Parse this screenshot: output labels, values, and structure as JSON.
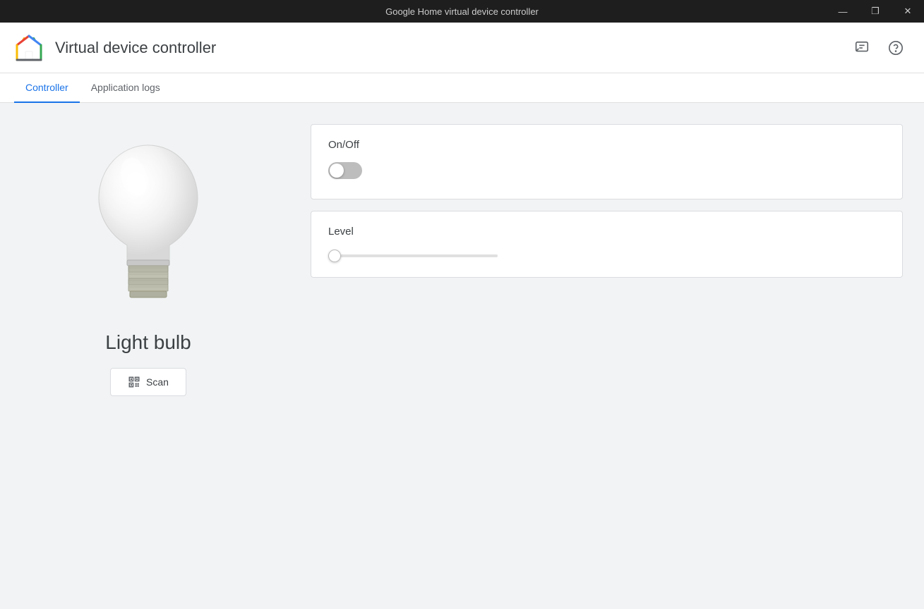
{
  "titleBar": {
    "title": "Google Home virtual device controller",
    "minimizeLabel": "—",
    "maximizeLabel": "❐",
    "closeLabel": "✕"
  },
  "header": {
    "appTitle": "Virtual device controller",
    "feedbackIconLabel": "feedback-icon",
    "helpIconLabel": "help-icon"
  },
  "tabs": [
    {
      "id": "controller",
      "label": "Controller",
      "active": true
    },
    {
      "id": "application-logs",
      "label": "Application logs",
      "active": false
    }
  ],
  "leftPanel": {
    "deviceName": "Light bulb",
    "scanButtonLabel": "Scan"
  },
  "rightPanel": {
    "controls": [
      {
        "id": "on-off",
        "label": "On/Off",
        "type": "toggle",
        "value": false
      },
      {
        "id": "level",
        "label": "Level",
        "type": "slider",
        "value": 0,
        "min": 0,
        "max": 100
      }
    ]
  }
}
